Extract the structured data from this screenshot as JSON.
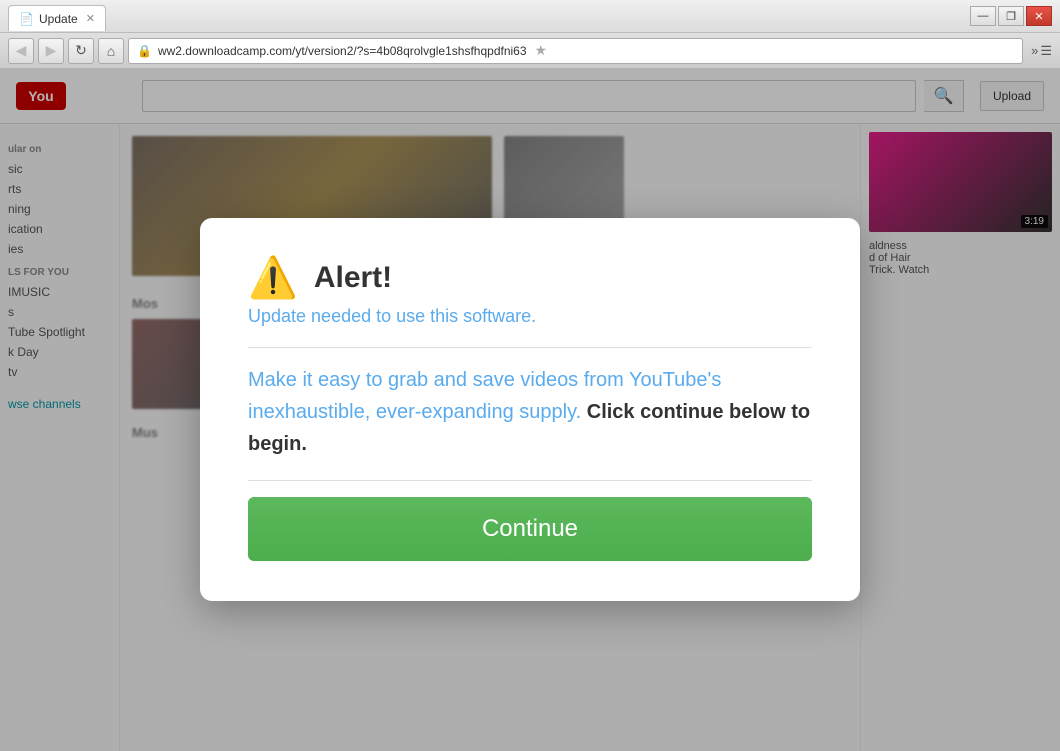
{
  "browser": {
    "tab_label": "Update",
    "address": "ww2.downloadcamp.com/yt/version2/?s=4b08qrolvgle1shsfhqpdfni63",
    "back_btn": "◀",
    "forward_btn": "▶",
    "refresh_btn": "↻",
    "home_btn": "⌂",
    "win_min": "—",
    "win_max": "❐",
    "win_close": "✕",
    "star": "★",
    "menu": "»"
  },
  "youtube": {
    "logo": "You",
    "upload_btn": "Upload",
    "search_placeholder": "",
    "sidebar": {
      "heading1": "ular on",
      "items1": [
        "sic",
        "rts",
        "ning",
        "ication",
        "ies"
      ],
      "heading2": "LS FOR YOU",
      "items2": [
        "IMUSIC",
        "s",
        "Tube Spotlight",
        "k Day",
        "tv"
      ],
      "browse": "wse channels"
    },
    "most_label": "Mos",
    "music_label": "Mus",
    "duration": "3:19",
    "right_panel_text1": "aldness",
    "right_panel_text2": "d of Hair",
    "right_panel_text3": "Trick. Watch"
  },
  "modal": {
    "title": "Alert!",
    "subtitle": "Update needed to use this software.",
    "body_colored": "Make it easy to grab and save videos from YouTube's inexhaustible, ever-expanding supply.",
    "body_bold": "Click continue below to begin.",
    "continue_label": "Continue"
  }
}
